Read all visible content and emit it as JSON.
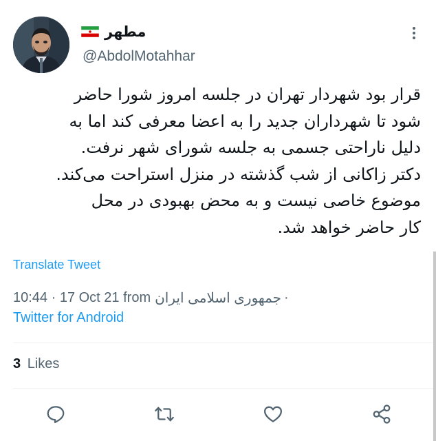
{
  "tweet": {
    "display_name": "مطهر",
    "handle": "@AbdolMotahhar",
    "flag_icon": "iran-flag-icon",
    "text_lines": [
      "قرار بود شهردار تهران در جلسه امروز شورا حاضر",
      "شود تا شهرداران جدید را به اعضا معرفی کند اما به",
      "دلیل ناراحتی جسمی به جلسه شورای شهر نرفت.",
      "دکتر زاکانی از شب گذشته در منزل استراحت می‌کند.",
      "موضوع خاصی نیست و به محض بهبودی در محل",
      "کار حاضر خواهد شد."
    ],
    "translate_label": "Translate Tweet",
    "time": "10:44 · 17 Oct 21 from",
    "location": "جمهوری اسلامی ایران",
    "location_separator": "·",
    "source": "Twitter for Android",
    "likes_count": "3",
    "likes_label": "Likes"
  },
  "actions": [
    {
      "icon": "reply-icon"
    },
    {
      "icon": "retweet-icon"
    },
    {
      "icon": "like-icon"
    },
    {
      "icon": "share-icon"
    }
  ],
  "colors": {
    "accent": "#1d9bf0",
    "text": "#0f1419",
    "secondary": "#536471",
    "divider": "#eff3f4"
  }
}
